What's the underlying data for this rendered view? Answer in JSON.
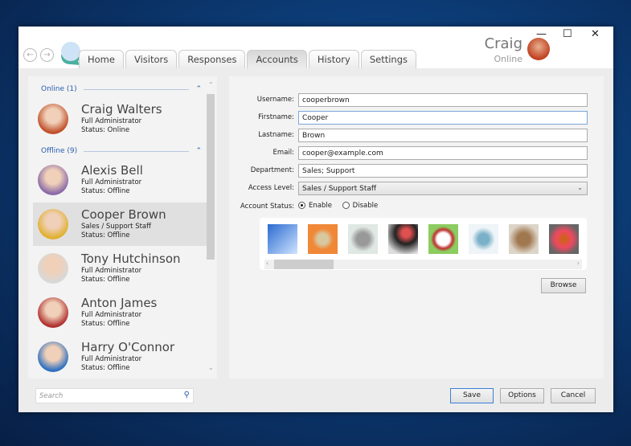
{
  "header": {
    "tabs": [
      "Home",
      "Visitors",
      "Responses",
      "Accounts",
      "History",
      "Settings"
    ],
    "active_tab": "Accounts",
    "user_name": "Craig",
    "user_status": "Online",
    "minimize": "—",
    "maximize": "☐",
    "close": "✕"
  },
  "contacts": {
    "online_group": "Online  (1)",
    "offline_group": "Offline  (9)",
    "items": [
      {
        "name": "Craig Walters",
        "role": "Full Administrator",
        "status": "Status: Online",
        "color": "#c0502a"
      },
      {
        "name": "Alexis Bell",
        "role": "Full Administrator",
        "status": "Status: Offline",
        "color": "#8a6aa8"
      },
      {
        "name": "Cooper Brown",
        "role": "Sales / Support Staff",
        "status": "Status: Offline",
        "color": "#e0b030"
      },
      {
        "name": "Tony Hutchinson",
        "role": "Full Administrator",
        "status": "Status: Offline",
        "color": "#d8d8d8"
      },
      {
        "name": "Anton James",
        "role": "Full Administrator",
        "status": "Status: Offline",
        "color": "#b03030"
      },
      {
        "name": "Harry O'Connor",
        "role": "Full Administrator",
        "status": "Status: Offline",
        "color": "#3070c0"
      }
    ],
    "search_placeholder": "Search"
  },
  "form": {
    "username_label": "Username:",
    "username": "cooperbrown",
    "firstname_label": "Firstname:",
    "firstname": "Cooper",
    "lastname_label": "Lastname:",
    "lastname": "Brown",
    "email_label": "Email:",
    "email": "cooper@example.com",
    "department_label": "Department:",
    "department": "Sales; Support",
    "access_label": "Access Level:",
    "access": "Sales / Support Staff",
    "status_label": "Account Status:",
    "enable": "Enable",
    "disable": "Disable",
    "selected_status": "Enable",
    "browse": "Browse"
  },
  "footer": {
    "save": "Save",
    "options": "Options",
    "cancel": "Cancel"
  }
}
